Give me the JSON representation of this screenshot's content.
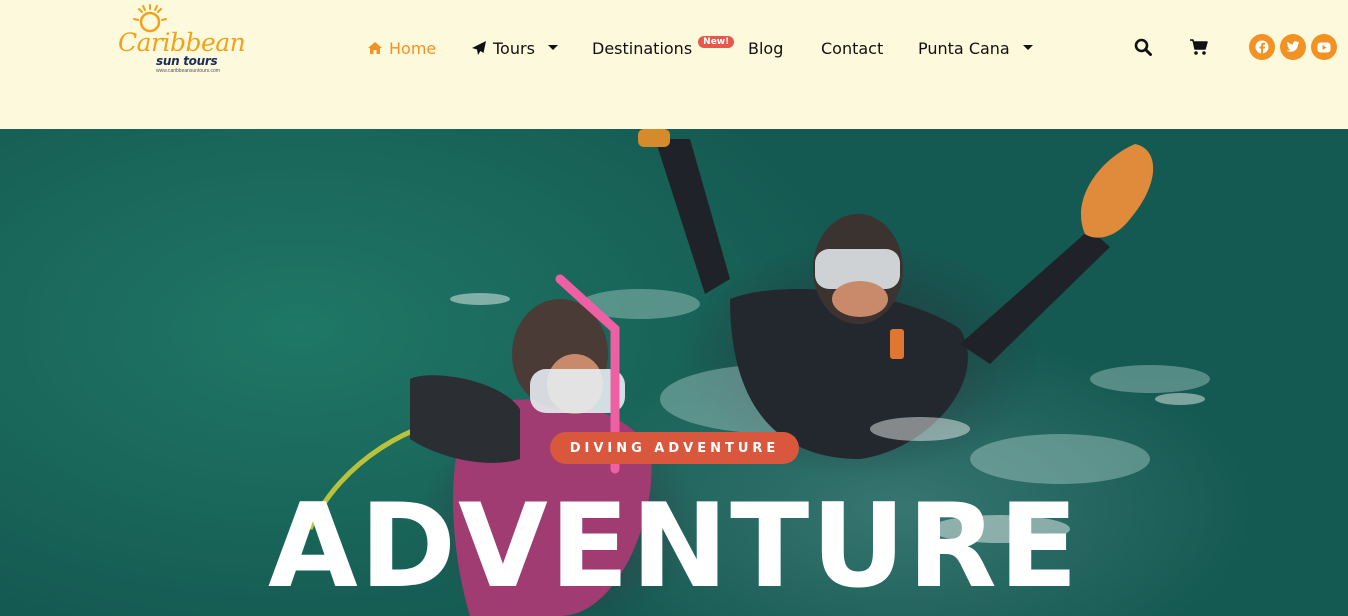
{
  "brand": {
    "logo_main": "Caribbean",
    "logo_sub": "sun tours",
    "logo_url": "www.caribbeansuntours.com",
    "accent_color": "#f29223"
  },
  "nav": {
    "items": [
      {
        "label": "Home",
        "icon": "home-icon",
        "active": true
      },
      {
        "label": "Tours",
        "icon": "paper-plane-icon",
        "dropdown": true
      },
      {
        "label": "Destinations",
        "badge": "New!"
      },
      {
        "label": "Blog"
      },
      {
        "label": "Contact"
      },
      {
        "label": "Punta Cana",
        "dropdown": true
      }
    ]
  },
  "tools": {
    "search_icon": "search-icon",
    "cart_icon": "cart-icon"
  },
  "social": [
    "facebook-icon",
    "twitter-icon",
    "youtube-icon"
  ],
  "hero": {
    "tag": "DIVING ADVENTURE",
    "title": "ADVENTURE",
    "tag_color": "#d9573d"
  }
}
